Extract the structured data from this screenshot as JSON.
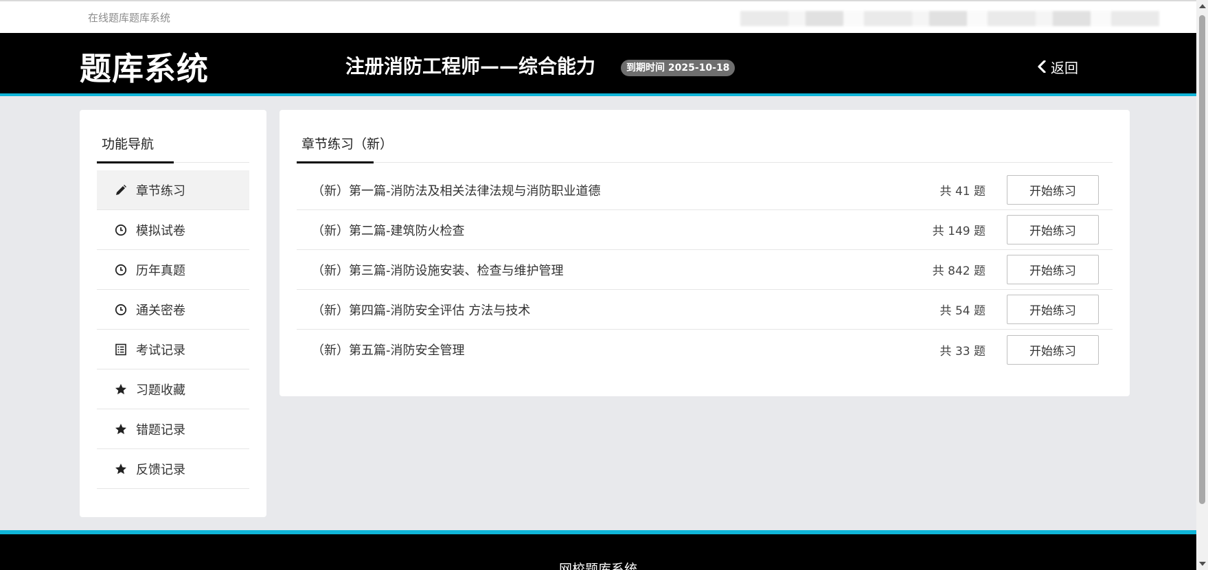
{
  "topbar": {
    "site_name": "在线题库题库系统"
  },
  "header": {
    "logo": "题库系统",
    "exam_title": "注册消防工程师——综合能力",
    "expire_badge": "到期时间 2025-10-18",
    "back_label": "返回"
  },
  "sidebar": {
    "title": "功能导航",
    "items": [
      {
        "label": "章节练习",
        "icon": "pencil-icon",
        "active": true
      },
      {
        "label": "模拟试卷",
        "icon": "clock-icon"
      },
      {
        "label": "历年真题",
        "icon": "clock-icon"
      },
      {
        "label": "通关密卷",
        "icon": "clock-icon"
      },
      {
        "label": "考试记录",
        "icon": "list-icon"
      },
      {
        "label": "习题收藏",
        "icon": "star-icon"
      },
      {
        "label": "错题记录",
        "icon": "star-icon"
      },
      {
        "label": "反馈记录",
        "icon": "star-icon"
      }
    ]
  },
  "main": {
    "tab_label": "章节练习（新）",
    "chapters": [
      {
        "name": "（新）第一篇-消防法及相关法律法规与消防职业道德",
        "count": "共 41 题",
        "button": "开始练习"
      },
      {
        "name": "（新）第二篇-建筑防火检查",
        "count": "共 149 题",
        "button": "开始练习"
      },
      {
        "name": "（新）第三篇-消防设施安装、检查与维护管理",
        "count": "共 842 题",
        "button": "开始练习"
      },
      {
        "name": "（新）第四篇-消防安全评估 方法与技术",
        "count": "共 54 题",
        "button": "开始练习"
      },
      {
        "name": "（新）第五篇-消防安全管理",
        "count": "共 33 题",
        "button": "开始练习"
      }
    ]
  },
  "footer": {
    "text": "网校题库系统"
  },
  "colors": {
    "accent": "#0fb5d8",
    "header_bg": "#000000",
    "page_bg": "#e8e9ec"
  }
}
